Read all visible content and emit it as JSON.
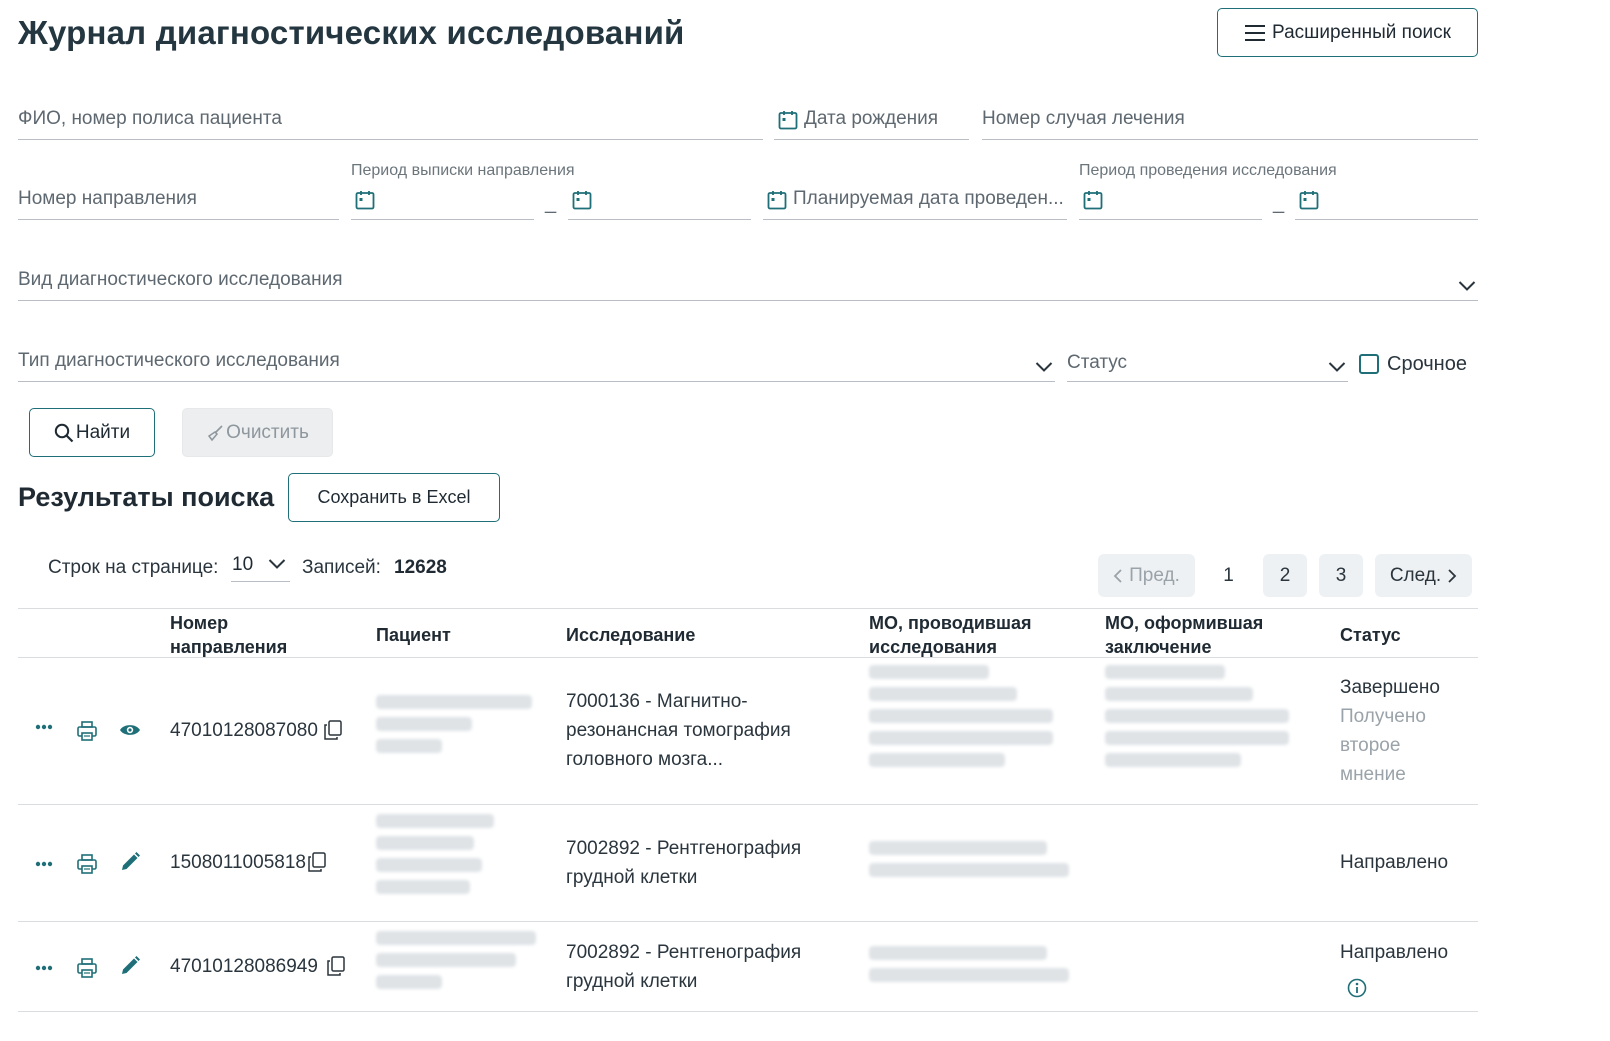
{
  "header": {
    "title": "Журнал диагностических исследований",
    "advanced_search_label": "Расширенный поиск"
  },
  "filters": {
    "patient_placeholder": "ФИО, номер полиса пациента",
    "birth_date_placeholder": "Дата рождения",
    "case_number_placeholder": "Номер случая лечения",
    "referral_number_placeholder": "Номер направления",
    "issue_period_label": "Период выписки направления",
    "planned_date_placeholder": "Планируемая дата проведен...",
    "study_period_label": "Период проведения исследования",
    "study_kind_placeholder": "Вид диагностического исследования",
    "study_type_placeholder": "Тип диагностического исследования",
    "status_placeholder": "Статус",
    "urgent_label": "Срочное",
    "range_separator": "_",
    "find_label": "Найти",
    "clear_label": "Очистить"
  },
  "results": {
    "title": "Результаты поиска",
    "export_label": "Сохранить в Excel",
    "rows_per_page_label": "Строк на странице:",
    "rows_per_page_value": "10",
    "records_label": "Записей:",
    "records_value": "12628"
  },
  "pagination": {
    "prev_label": "Пред.",
    "next_label": "След.",
    "pages": [
      "1",
      "2",
      "3"
    ],
    "current_page": "1"
  },
  "table": {
    "columns": {
      "referral": "Номер направления",
      "patient": "Пациент",
      "study": "Исследование",
      "mo_performed": "МО, проводившая исследования",
      "mo_concluded": "МО, оформившая заключение",
      "status": "Статус"
    },
    "rows": [
      {
        "referral": "47010128087080",
        "study": "7000136 - Магнитно-резонансная томография головного мозга...",
        "status": "Завершено",
        "status_sub": "Получено второе мнение",
        "action_icon": "eye-icon"
      },
      {
        "referral": "1508011005818",
        "study": "7002892 - Рентгенография грудной клетки",
        "status": "Направлено",
        "status_sub": "",
        "action_icon": "pencil-icon"
      },
      {
        "referral": "47010128086949",
        "study": "7002892 - Рентгенография грудной клетки",
        "status": "Направлено",
        "status_sub": "",
        "action_icon": "pencil-icon"
      }
    ]
  },
  "colors": {
    "accent": "#1f6f78",
    "title": "#243640",
    "placeholder": "#5e6870",
    "divider": "#d9dde0"
  }
}
